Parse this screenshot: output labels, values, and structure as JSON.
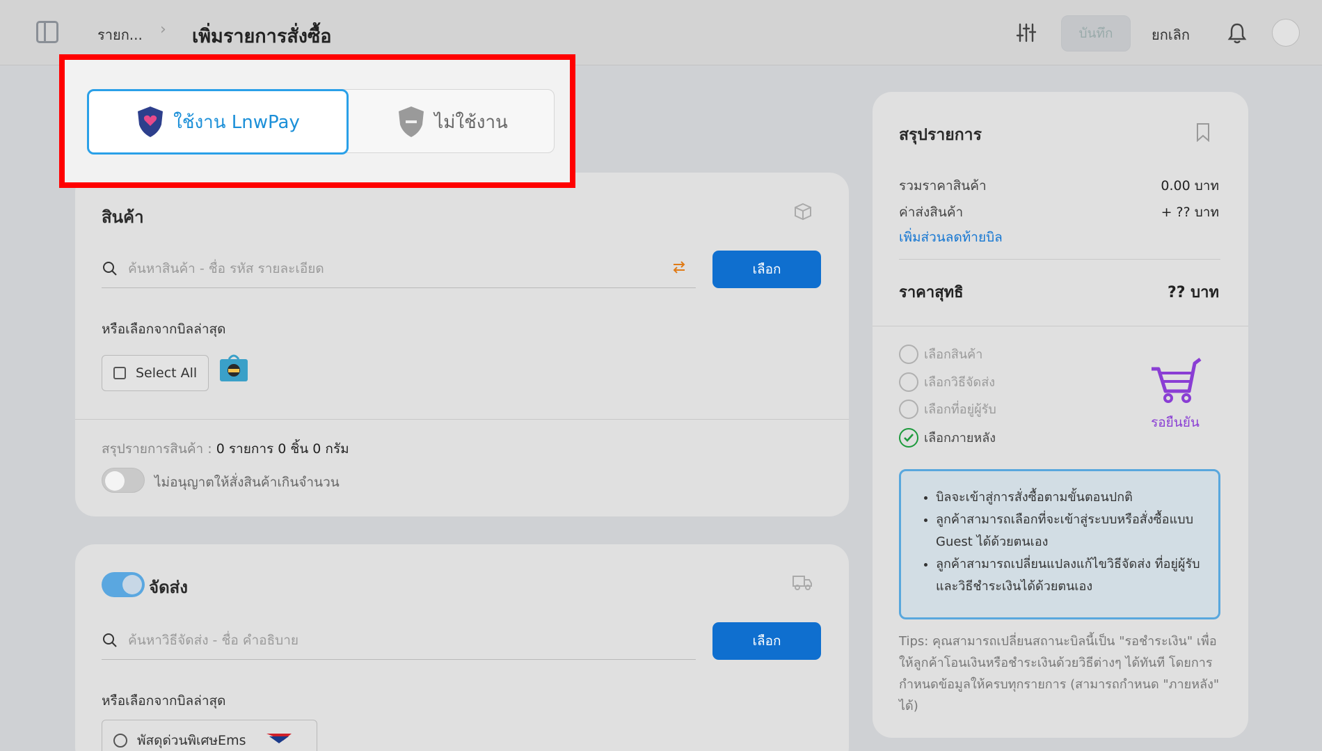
{
  "topbar": {
    "breadcrumb_parent": "รายก...",
    "breadcrumb_sep": "›",
    "title": "เพิ่มรายการสั่งซื้อ",
    "save_label": "บันทึก",
    "cancel_label": "ยกเลิก"
  },
  "payment": {
    "use_label": "ใช้งาน LnwPay",
    "not_use_label": "ไม่ใช้งาน"
  },
  "products": {
    "title": "สินค้า",
    "search_placeholder": "ค้นหาสินค้า - ชื่อ รหัส รายละเอียด",
    "select_button": "เลือก",
    "or_select_label": "หรือเลือกจากบิลล่าสุด",
    "select_all": "Select All",
    "summary_label": "สรุปรายการสินค้า :",
    "summary_value": "0 รายการ 0 ชิ้น 0 กรัม",
    "overorder_toggle_label": "ไม่อนุญาตให้สั่งสินค้าเกินจำนวน"
  },
  "shipping": {
    "title": "จัดส่ง",
    "search_placeholder": "ค้นหาวิธีจัดส่ง - ชื่อ คำอธิบาย",
    "select_button": "เลือก",
    "or_select_label": "หรือเลือกจากบิลล่าสุด",
    "option_label": "พัสดุด่วนพิเศษEms"
  },
  "summary": {
    "title": "สรุปรายการ",
    "rows": [
      {
        "label": "รวมราคาสินค้า",
        "value": "0.00 บาท"
      },
      {
        "label": "ค่าส่งสินค้า",
        "value": "+ ?? บาท"
      }
    ],
    "discount_link": "เพิ่มส่วนลดท้ายบิล",
    "net_label": "ราคาสุทธิ",
    "net_value": "?? บาท",
    "steps": [
      {
        "label": "เลือกสินค้า",
        "done": false
      },
      {
        "label": "เลือกวิธีจัดส่ง",
        "done": false
      },
      {
        "label": "เลือกที่อยู่ผู้รับ",
        "done": false
      },
      {
        "label": "เลือกภายหลัง",
        "done": true
      }
    ],
    "status_label": "รอยืนยัน",
    "tips": [
      "บิลจะเข้าสู่การสั่งซื้อตามขั้นตอนปกติ",
      "ลูกค้าสามารถเลือกที่จะเข้าสู่ระบบหรือสั่งซื้อแบบ Guest ได้ด้วยตนเอง",
      "ลูกค้าสามารถเปลี่ยนแปลงแก้ไขวิธีจัดส่ง ที่อยู่ผู้รับ และวิธีชำระเงินได้ด้วยตนเอง"
    ],
    "tips_note": "Tips: คุณสามารถเปลี่ยนสถานะบิลนี้เป็น \"รอชำระเงิน\" เพื่อให้ลูกค้าโอนเงินหรือชำระเงินด้วยวิธีต่างๆ ได้ทันที โดยการกำหนดข้อมูลให้ครบทุกรายการ (สามารถกำหนด \"ภายหลัง\" ได้)"
  },
  "colors": {
    "accent": "#0f6fcf",
    "highlight": "#ff0000",
    "active_tab": "#2aa0e8",
    "status": "#8a3ed4",
    "done": "#1d9a3c"
  }
}
